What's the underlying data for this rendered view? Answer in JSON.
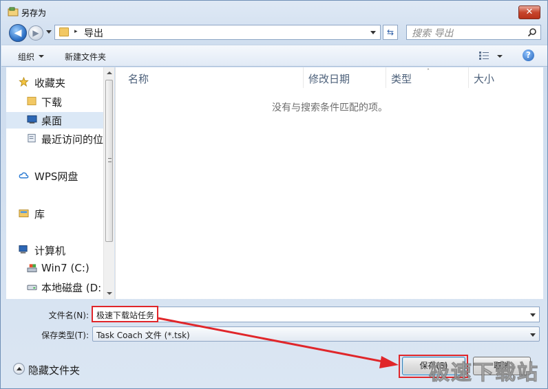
{
  "window": {
    "title": "另存为",
    "close_label": "✕"
  },
  "nav": {
    "back_glyph": "◀",
    "forward_glyph": "▶",
    "address_separator": "▸",
    "address_folder": "导出",
    "refresh_glyph": "⇆",
    "search_placeholder": "搜索 导出"
  },
  "toolbar": {
    "organize_label": "组织",
    "new_folder_label": "新建文件夹",
    "help_glyph": "?"
  },
  "sidebar": {
    "items": [
      {
        "label": "收藏夹",
        "icon": "star-icon"
      },
      {
        "label": "下载",
        "icon": "folder-icon"
      },
      {
        "label": "桌面",
        "icon": "desktop-icon",
        "selected": true
      },
      {
        "label": "最近访问的位",
        "icon": "recent-places-icon"
      },
      {
        "label": "WPS网盘",
        "icon": "cloud-icon"
      },
      {
        "label": "库",
        "icon": "library-icon"
      },
      {
        "label": "计算机",
        "icon": "computer-icon"
      },
      {
        "label": "Win7 (C:)",
        "icon": "system-drive-icon"
      },
      {
        "label": "本地磁盘 (D:",
        "icon": "local-drive-icon"
      }
    ]
  },
  "file_list": {
    "columns": [
      "名称",
      "修改日期",
      "类型",
      "大小"
    ],
    "sort_glyph": "˄",
    "empty_message": "没有与搜索条件匹配的项。"
  },
  "form": {
    "filename_label": "文件名(N):",
    "filename_value": "极速下载站任务",
    "filetype_label": "保存类型(T):",
    "filetype_value": "Task Coach 文件 (*.tsk)",
    "hide_folders_label": "隐藏文件夹",
    "save_label": "保存(S)",
    "cancel_label": "取消"
  },
  "watermark": {
    "text": "极速下载站"
  },
  "colors": {
    "highlight": "#e0262a",
    "accent": "#2b6fc4"
  }
}
